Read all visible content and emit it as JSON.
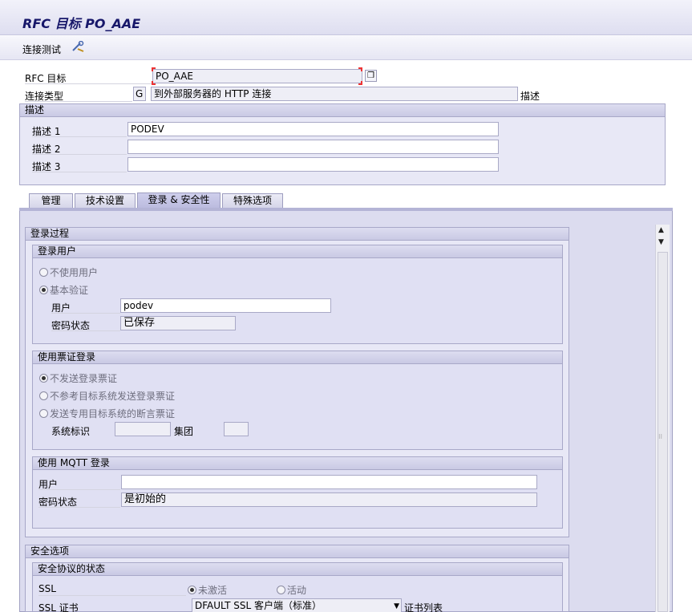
{
  "window": {
    "title": "RFC 目标 PO_AAE"
  },
  "toolbar": {
    "connection_test": "连接测试"
  },
  "header": {
    "rfc_dest_label": "RFC 目标",
    "rfc_dest_value": "PO_AAE",
    "conn_type_label": "连接类型",
    "conn_type_code": "G",
    "conn_type_desc": "到外部服务器的 HTTP 连接",
    "desc_right_label": "描述"
  },
  "description": {
    "title": "描述",
    "rows": [
      {
        "label": "描述 1",
        "value": "PODEV"
      },
      {
        "label": "描述 2",
        "value": ""
      },
      {
        "label": "描述 3",
        "value": ""
      }
    ]
  },
  "tabs": [
    {
      "label": "管理"
    },
    {
      "label": "技术设置"
    },
    {
      "label": "登录 & 安全性"
    },
    {
      "label": "特殊选项"
    }
  ],
  "logon": {
    "title": "登录过程",
    "user_group": {
      "title": "登录用户",
      "opt_no_user": "不使用用户",
      "opt_basic": "基本验证",
      "user_label": "用户",
      "user_value": "podev",
      "pwd_status_label": "密码状态",
      "pwd_status_value": "已保存"
    },
    "ticket_group": {
      "title": "使用票证登录",
      "opt1": "不发送登录票证",
      "opt2": "不参考目标系统发送登录票证",
      "opt3": "发送专用目标系统的断言票证",
      "sysid_label": "系统标识",
      "client_label": "集团"
    },
    "mqtt_group": {
      "title": "使用 MQTT 登录",
      "user_label": "用户",
      "pwd_status_label": "密码状态",
      "pwd_status_value": "是初始的"
    }
  },
  "security": {
    "title": "安全选项",
    "proto_title": "安全协议的状态",
    "ssl_label": "SSL",
    "ssl_inactive": "未激活",
    "ssl_active": "活动",
    "cert_label": "SSL 证书",
    "cert_value": "DFAULT SSL 客户端（标准）",
    "cert_list": "证书列表"
  }
}
